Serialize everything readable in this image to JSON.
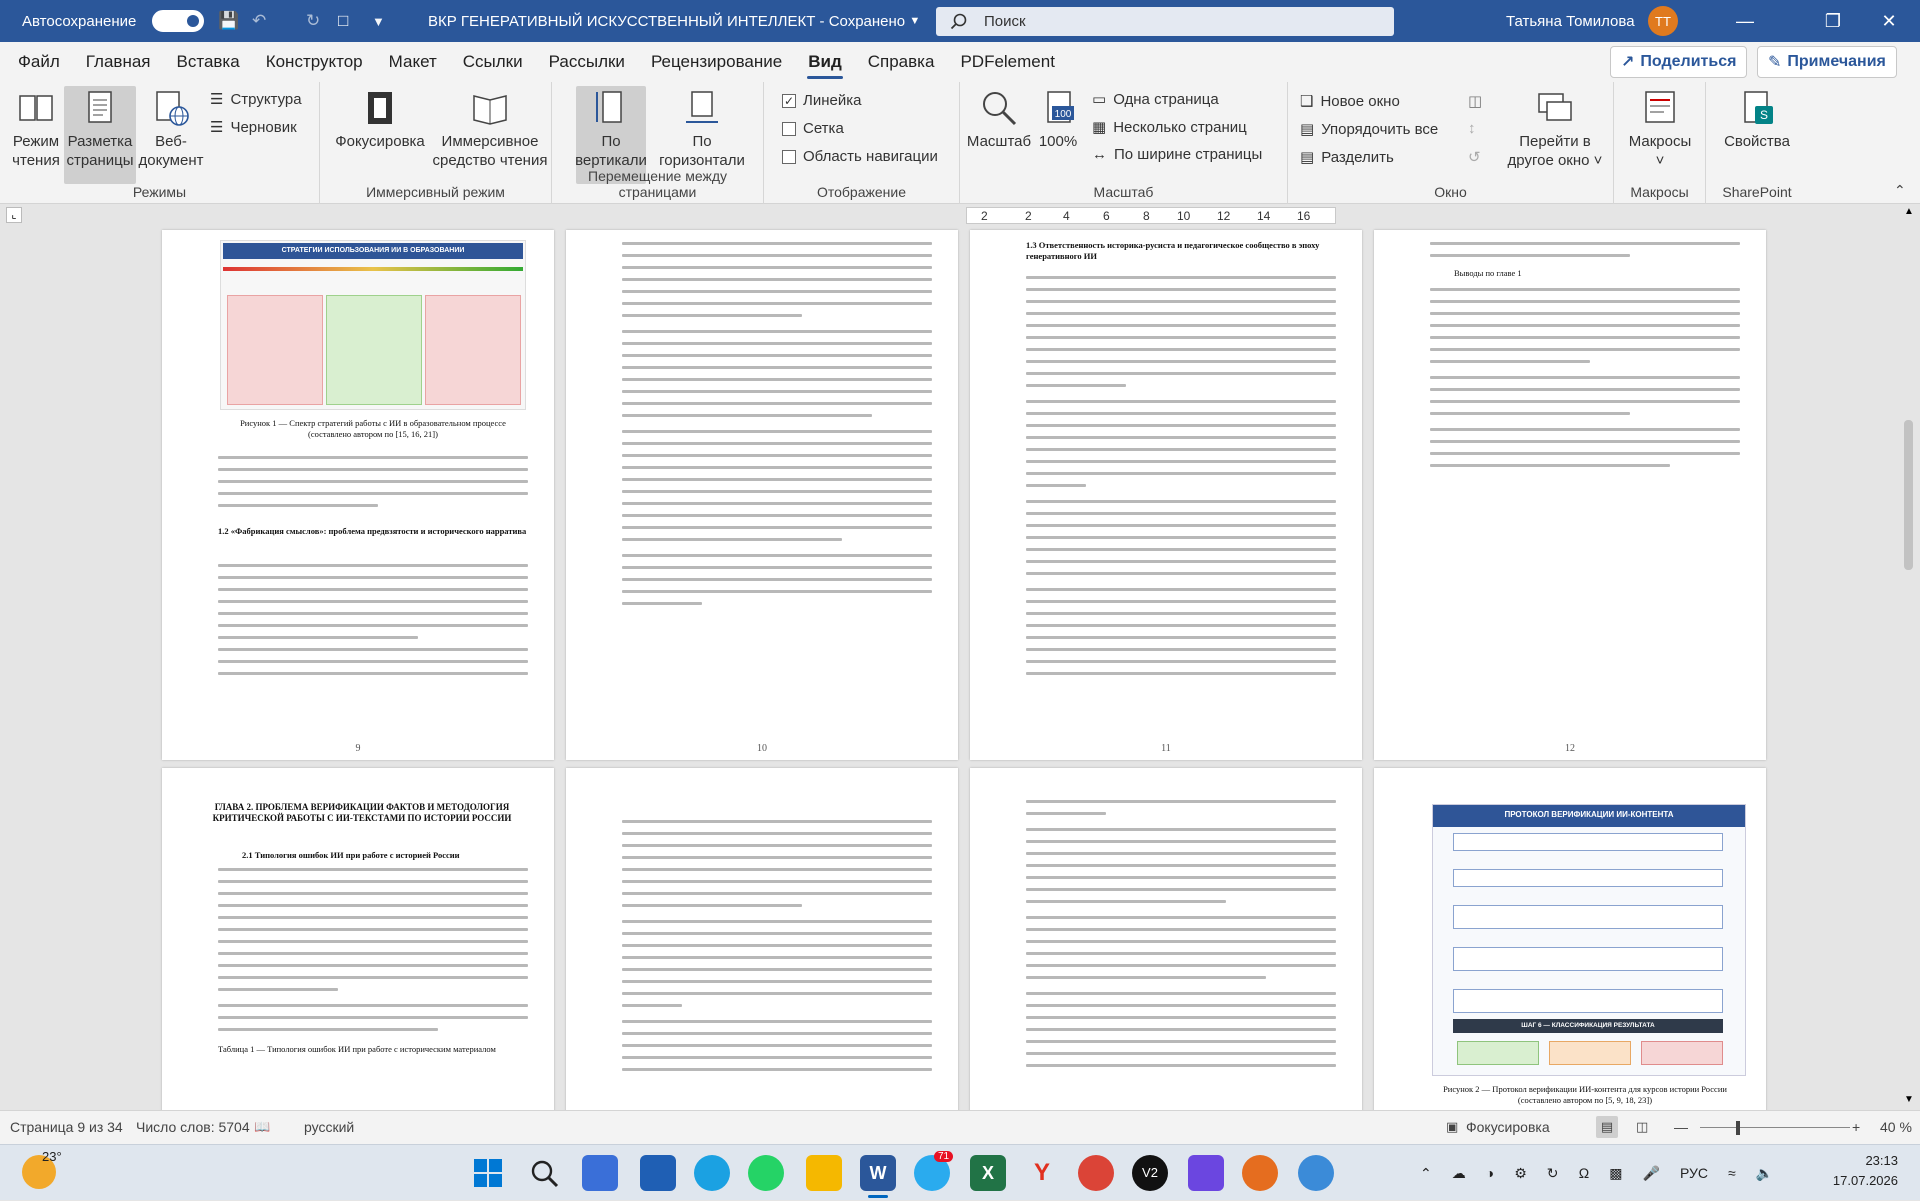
{
  "titlebar": {
    "autosave_label": "Автосохранение",
    "autosave_state": "Вкл",
    "doc_title": "ВКР ГЕНЕРАТИВНЫЙ ИСКУССТВЕННЫЙ ИНТЕЛЛЕКТ - Сохранено",
    "search_placeholder": "Поиск",
    "user_name": "Татьяна Томилова",
    "user_initials": "ТТ"
  },
  "menu": {
    "tabs": [
      "Файл",
      "Главная",
      "Вставка",
      "Конструктор",
      "Макет",
      "Ссылки",
      "Рассылки",
      "Рецензирование",
      "Вид",
      "Справка",
      "PDFelement"
    ],
    "active_tab": "Вид",
    "share_label": "Поделиться",
    "comments_label": "Примечания"
  },
  "ribbon": {
    "groups": {
      "modes": "Режимы",
      "immersive": "Иммерсивный режим",
      "page_movement": "Перемещение между страницами",
      "show": "Отображение",
      "zoom": "Масштаб",
      "window": "Окно",
      "macros": "Макросы",
      "sharepoint": "SharePoint"
    },
    "read_mode": [
      "Режим",
      "чтения"
    ],
    "print_layout": [
      "Разметка",
      "страницы"
    ],
    "web_layout": [
      "Веб-",
      "документ"
    ],
    "outline": "Структура",
    "draft": "Черновик",
    "focus": "Фокусировка",
    "immersive_reader": [
      "Иммерсивное",
      "средство чтения"
    ],
    "vertical": [
      "По",
      "вертикали"
    ],
    "side_to_side": [
      "По",
      "горизонтали"
    ],
    "ruler": "Линейка",
    "gridlines": "Сетка",
    "nav_pane": "Область навигации",
    "ruler_checked": true,
    "gridlines_checked": false,
    "nav_pane_checked": false,
    "zoom_btn": "Масштаб",
    "zoom_100": "100%",
    "one_page": "Одна страница",
    "multiple_pages": "Несколько страниц",
    "page_width": "По ширине страницы",
    "new_window": "Новое окно",
    "arrange_all": "Упорядочить все",
    "split": "Разделить",
    "switch_windows": [
      "Перейти в",
      "другое окно"
    ],
    "macros_btn": "Макросы",
    "properties_btn": "Свойства"
  },
  "ruler": {
    "numbers": [
      "2",
      "2",
      "4",
      "6",
      "8",
      "10",
      "12",
      "14",
      "16"
    ]
  },
  "pages": {
    "p9": {
      "num": "9",
      "fig_title": "СТРАТЕГИИ ИСПОЛЬЗОВАНИЯ ИИ В ОБРАЗОВАНИИ",
      "caption": "Рисунок 1 — Спектр стратегий работы с ИИ в образовательном процессе (составлено автором по [15, 16, 21])",
      "heading": "1.2 «Фабрикация смыслов»: проблема предвзятости и исторического нарратива"
    },
    "p10": {
      "num": "10"
    },
    "p11": {
      "num": "11",
      "heading": "1.3 Ответственность историка-русиста и педагогическое сообщество в эпоху генеративного ИИ"
    },
    "p12": {
      "num": "12",
      "heading": "Выводы по главе 1"
    },
    "p13": {
      "heading": "ГЛАВА 2. ПРОБЛЕМА ВЕРИФИКАЦИИ ФАКТОВ И МЕТОДОЛОГИЯ КРИТИЧЕСКОЙ РАБОТЫ С ИИ-ТЕКСТАМИ ПО ИСТОРИИ РОССИИ",
      "subheading": "2.1 Типология ошибок ИИ при работе с историей России",
      "table_caption": "Таблица 1 — Типология ошибок ИИ при работе с историческим материалом"
    },
    "p16": {
      "fig_title": "ПРОТОКОЛ ВЕРИФИКАЦИИ ИИ-КОНТЕНТА",
      "step6": "ШАГ 6 — КЛАССИФИКАЦИЯ РЕЗУЛЬТАТА",
      "caption": "Рисунок 2 — Протокол верификации ИИ-контента для курсов истории России (составлено автором по [5, 9, 18, 23])"
    }
  },
  "status": {
    "page": "Страница 9 из 34",
    "words": "Число слов: 5704",
    "lang": "русский",
    "focus": "Фокусировка",
    "zoom": "40 %"
  },
  "taskbar": {
    "temp": "23°",
    "lang": "РУС",
    "time": "23:13",
    "date": "17.07.2026",
    "telegram_badge": "71"
  },
  "colors": {
    "accent": "#2b579a",
    "titlebar": "#2b579a"
  }
}
